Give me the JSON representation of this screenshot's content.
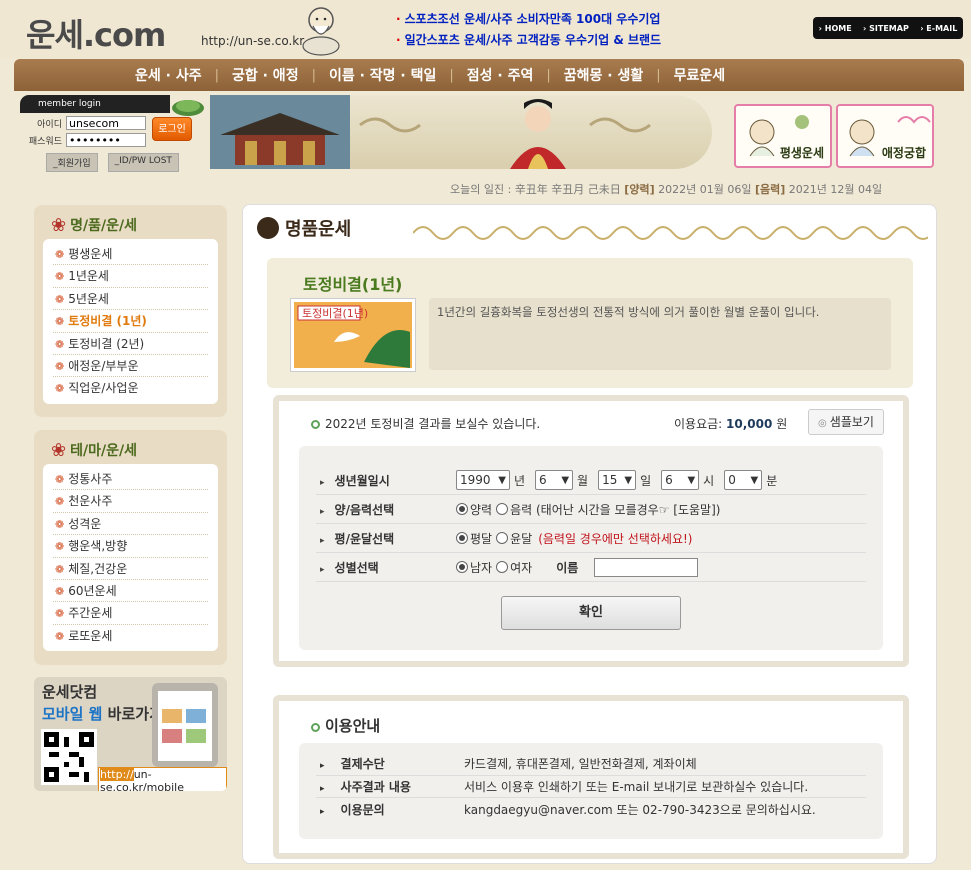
{
  "header": {
    "logo": "운세.com",
    "url": "http://un-se.co.kr",
    "notices": [
      "스포츠조선 운세/사주 소비자만족 100대 우수기업",
      "일간스포츠 운세/사주 고객감동 우수기업 & 브랜드"
    ],
    "toplinks": [
      "HOME",
      "SITEMAP",
      "E-MAIL"
    ]
  },
  "nav": [
    "운세 · 사주",
    "궁합 · 애정",
    "이름 · 작명 · 택일",
    "점성 · 주역",
    "꿈해몽 · 생활",
    "무료운세"
  ],
  "login": {
    "title": "member login",
    "id_label": "아이디",
    "pw_label": "패스워드",
    "id_value": "unsecom",
    "pw_value": "••••••••",
    "login_button": "로그인",
    "join_button": "_회원가입",
    "lost_button": "_ID/PW LOST"
  },
  "quick_links": [
    "평생운세",
    "애정궁합"
  ],
  "date": {
    "prefix": "오늘의 일진 : 辛丑年 辛丑月 己未日",
    "solar_tag": "[양력]",
    "solar": "2022년 01월 06일",
    "lunar_tag": "[음력]",
    "lunar": "2021년 12월 04일"
  },
  "sidebar": {
    "premium": {
      "title": "명/품/운/세",
      "items": [
        "평생운세",
        "1년운세",
        "5년운세",
        "토정비결 (1년)",
        "토정비결 (2년)",
        "애정운/부부운",
        "직업운/사업운"
      ],
      "active_index": 3
    },
    "theme": {
      "title": "테/마/운/세",
      "items": [
        "정통사주",
        "천운사주",
        "성격운",
        "행운색,방향",
        "체질,건강운",
        "60년운세",
        "주간운세",
        "로또운세"
      ]
    },
    "mobile": {
      "line1": "운세닷컴",
      "line2_blue": "모바일 웹",
      "line2_rest": "바로가기!",
      "url_prefix": "http://",
      "url_rest": "un-se.co.kr/mobile"
    }
  },
  "main": {
    "section_title": "명품운세",
    "product": {
      "name": "토정비결(1년)",
      "thumb_label": "토정비결(1년)",
      "description": "1년간의 길흉화복을 토정선생의 전통적 방식에 의거 풀이한 월별 운풀이 입니다."
    },
    "form": {
      "header": "2022년 토정비결 결과를 보실수 있습니다.",
      "price_label": "이용요금:",
      "price_value": "10,000",
      "price_unit": "원",
      "sample_button": "샘플보기",
      "rows": {
        "birth": {
          "label": "생년월일시",
          "year": "1990",
          "year_unit": "년",
          "month": "6",
          "month_unit": "월",
          "day": "15",
          "day_unit": "일",
          "hour": "6",
          "hour_unit": "시",
          "minute": "0",
          "minute_unit": "분"
        },
        "calendar": {
          "label": "양/음력선택",
          "opt1": "양력",
          "opt2": "음력 (태어난 시간을 모를경우☞ [도움말])"
        },
        "leap": {
          "label": "평/윤달선택",
          "opt1": "평달",
          "opt2": "윤달",
          "note": "(음력일 경우에만 선택하세요!)"
        },
        "gender": {
          "label": "성별선택",
          "opt1": "남자",
          "opt2": "여자",
          "name_label": "이름"
        }
      },
      "confirm_button": "확인"
    },
    "info": {
      "title": "이용안내",
      "rows": [
        {
          "label": "결제수단",
          "value": "카드결제, 휴대폰결제, 일반전화결제, 계좌이체"
        },
        {
          "label": "사주결과 내용",
          "value": "서비스 이용후 인쇄하기 또는 E-mail 보내기로 보관하실수 있습니다."
        },
        {
          "label": "이용문의",
          "value": "kangdaegyu@naver.com 또는 02-790-3423으로 문의하십시요."
        }
      ]
    }
  }
}
